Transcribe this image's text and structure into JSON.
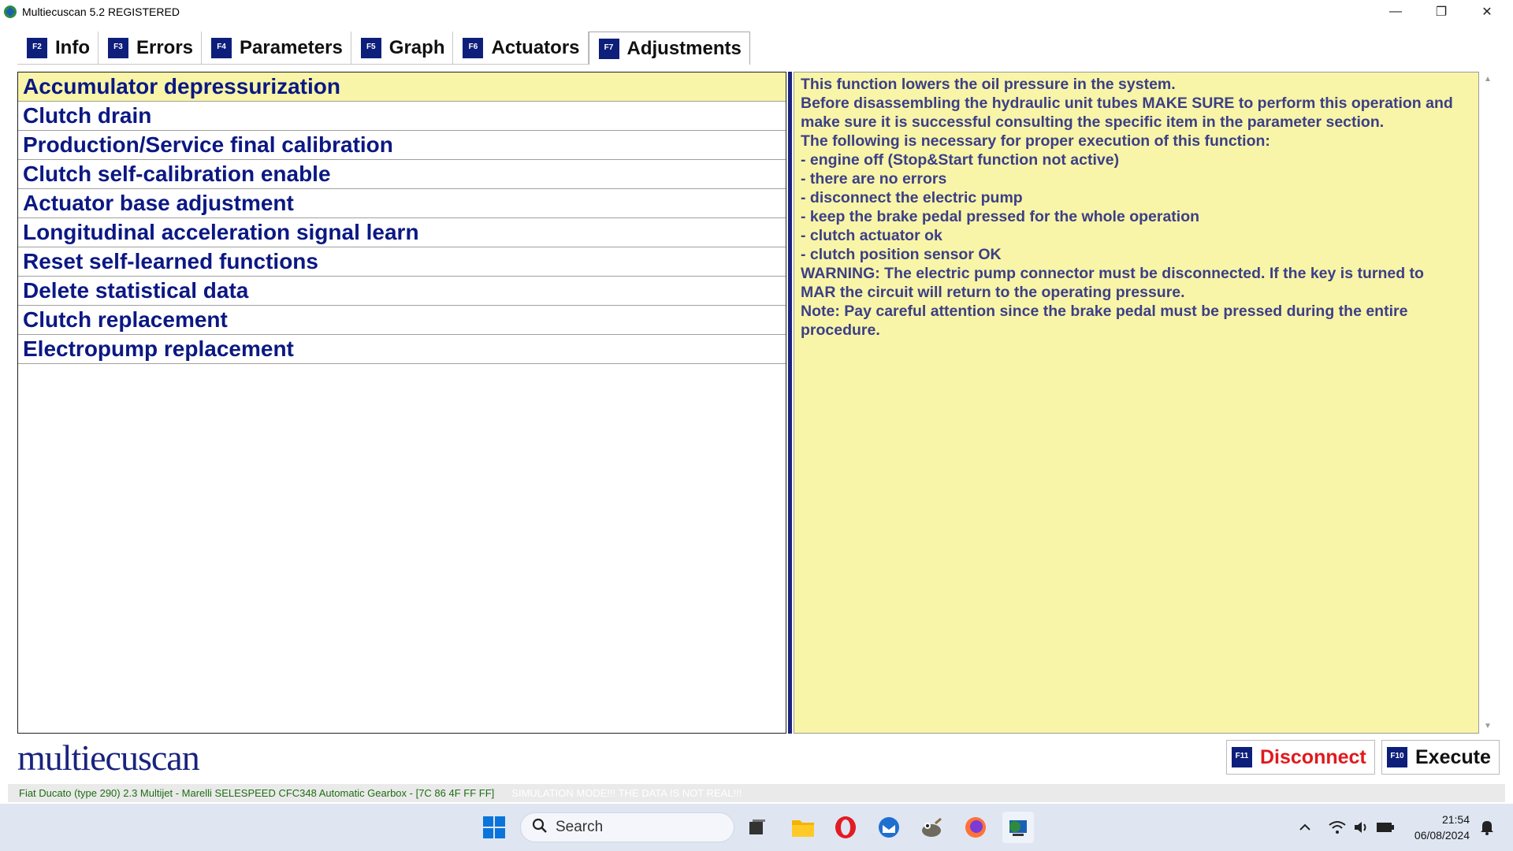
{
  "window": {
    "title": "Multiecuscan 5.2 REGISTERED",
    "minimize_glyph": "—",
    "restore_glyph": "❐",
    "close_glyph": "✕"
  },
  "tabs": [
    {
      "key": "F2",
      "label": "Info"
    },
    {
      "key": "F3",
      "label": "Errors"
    },
    {
      "key": "F4",
      "label": "Parameters"
    },
    {
      "key": "F5",
      "label": "Graph"
    },
    {
      "key": "F6",
      "label": "Actuators"
    },
    {
      "key": "F7",
      "label": "Adjustments"
    }
  ],
  "active_tab": "Adjustments",
  "adjustments": [
    "Accumulator depressurization",
    "Clutch drain",
    "Production/Service final calibration",
    "Clutch self-calibration enable",
    "Actuator base adjustment",
    "Longitudinal acceleration signal learn",
    "Reset self-learned functions",
    "Delete statistical data",
    "Clutch replacement",
    "Electropump replacement"
  ],
  "selected_adjustment": "Accumulator depressurization",
  "description": [
    "This function lowers the oil pressure in the system.",
    "Before disassembling the hydraulic unit tubes MAKE SURE to perform this operation and",
    "make sure it is successful consulting the specific item in the parameter section.",
    "The following is necessary for proper execution of this function:",
    "- engine off (Stop&Start function not active)",
    "- there are no errors",
    "- disconnect the electric pump",
    "- keep the brake pedal pressed for the whole operation",
    "- clutch actuator ok",
    "- clutch position sensor OK",
    "WARNING: The electric pump connector must be disconnected. If the key is turned to",
    "MAR the circuit will return to the operating pressure.",
    "Note: Pay careful attention since the brake pedal must be pressed during the entire",
    "procedure."
  ],
  "logo_text": "multiecuscan",
  "buttons": {
    "disconnect": {
      "key": "F11",
      "label": "Disconnect",
      "color": "#e0191d"
    },
    "execute": {
      "key": "F10",
      "label": "Execute",
      "color": "#111111"
    }
  },
  "statusbar": {
    "vehicle": "Fiat Ducato (type 290) 2.3 Multijet - Marelli SELESPEED CFC348 Automatic Gearbox - [7C 86 4F FF FF]",
    "mode": "SIMULATION MODE!!! THE DATA IS NOT REAL!!!"
  },
  "taskbar": {
    "search_placeholder": "Search",
    "time": "21:54",
    "date": "06/08/2024",
    "icons": [
      "windows-start-icon",
      "search-icon",
      "task-view-icon",
      "file-explorer-icon",
      "opera-icon",
      "thunderbird-icon",
      "gimp-icon",
      "firefox-icon",
      "multiecuscan-icon",
      "chevron-up-icon",
      "wifi-icon",
      "volume-icon",
      "battery-icon",
      "notification-icon"
    ]
  },
  "colors": {
    "accent_navy": "#1a237e",
    "highlight_yellow": "#f8f5a8",
    "list_text": "#0b1883",
    "desc_text": "#3c3f86",
    "status_green": "#1d6e12"
  }
}
